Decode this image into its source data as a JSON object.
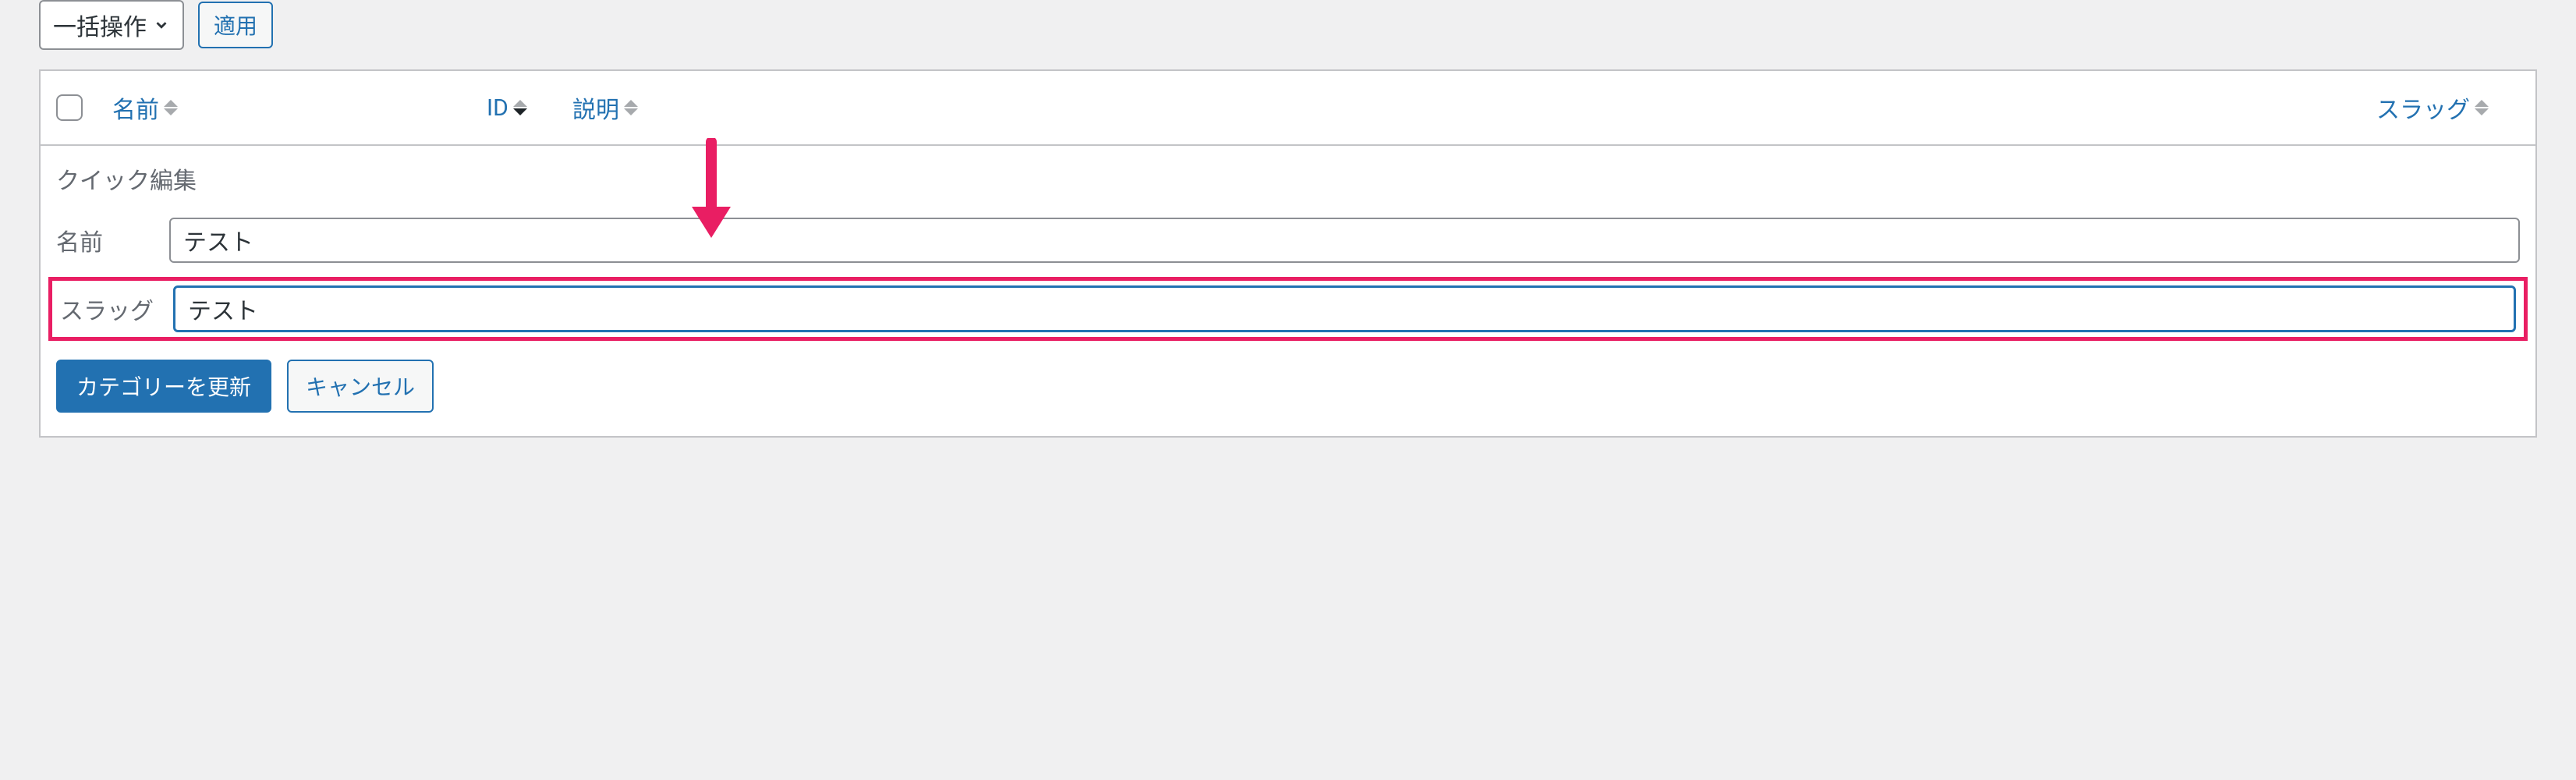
{
  "toolbar": {
    "bulk_action_label": "一括操作",
    "apply_label": "適用"
  },
  "columns": {
    "name": "名前",
    "id": "ID",
    "description": "説明",
    "slug": "スラッグ"
  },
  "quick_edit": {
    "title": "クイック編集",
    "name_label": "名前",
    "name_value": "テスト",
    "slug_label": "スラッグ",
    "slug_value": "テスト",
    "update_label": "カテゴリーを更新",
    "cancel_label": "キャンセル"
  },
  "annotation": {
    "arrow_color": "#e91e63",
    "highlight_border_color": "#e91e63"
  }
}
